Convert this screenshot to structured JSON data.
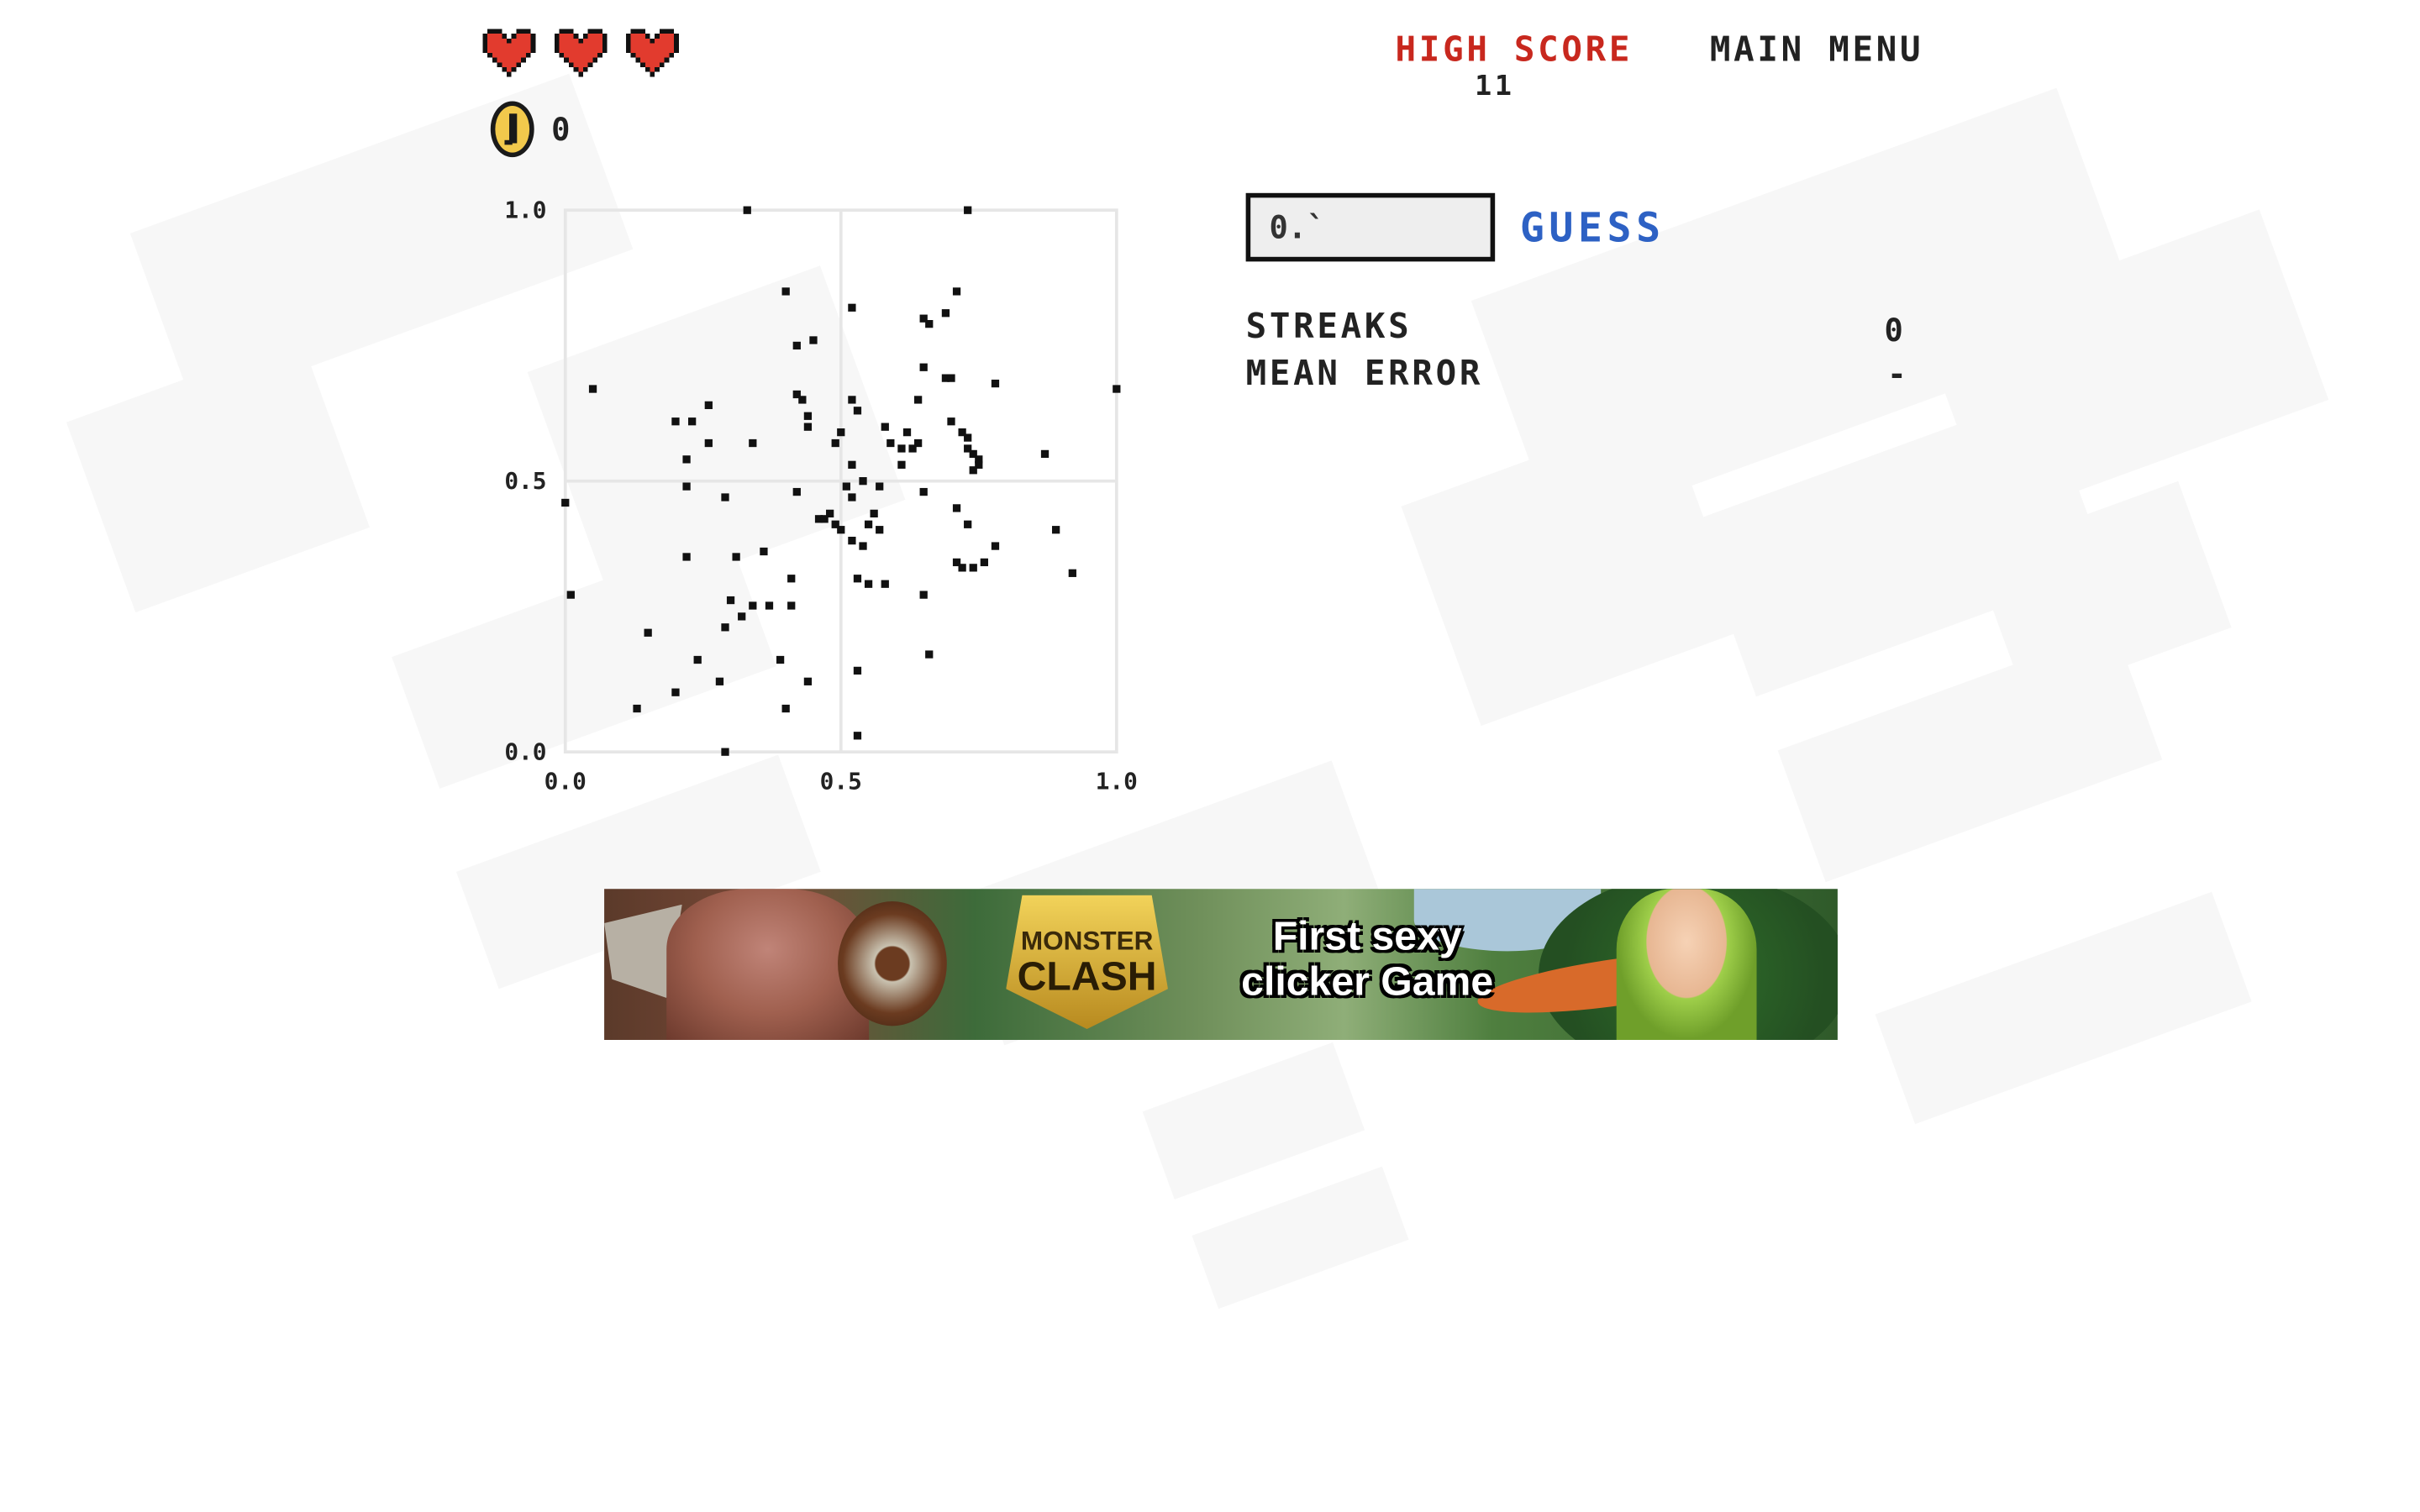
{
  "status": {
    "hearts": 3,
    "coins": "0"
  },
  "header": {
    "high_score_label": "HIGH SCORE",
    "high_score_value": "11",
    "main_menu_label": "MAIN MENU"
  },
  "guess": {
    "input_value": "0.`",
    "button_label": "GUESS"
  },
  "stats": {
    "streaks_label": "STREAKS",
    "streaks_value": "0",
    "mean_error_label": "MEAN ERROR",
    "mean_error_value": "-"
  },
  "ad": {
    "logo_top": "MONSTER",
    "logo_bottom": "CLASH",
    "headline": "First sexy clicker Game"
  },
  "colors": {
    "heart": "#e23b2e",
    "high_score": "#c8281e",
    "guess_button": "#2d61c4",
    "coin": "#f2c94c"
  },
  "chart_data": {
    "type": "scatter",
    "xlim": [
      0,
      1
    ],
    "ylim": [
      0,
      1
    ],
    "xticks": [
      "0.0",
      "0.5",
      "1.0"
    ],
    "yticks": [
      "0.0",
      "0.5",
      "1.0"
    ],
    "grid": true,
    "points": [
      [
        0.33,
        1.0
      ],
      [
        0.73,
        1.0
      ],
      [
        0.4,
        0.85
      ],
      [
        0.52,
        0.82
      ],
      [
        0.71,
        0.85
      ],
      [
        0.69,
        0.81
      ],
      [
        0.65,
        0.8
      ],
      [
        0.66,
        0.79
      ],
      [
        0.45,
        0.76
      ],
      [
        0.42,
        0.75
      ],
      [
        0.65,
        0.71
      ],
      [
        0.69,
        0.69
      ],
      [
        0.7,
        0.69
      ],
      [
        0.78,
        0.68
      ],
      [
        1.0,
        0.67
      ],
      [
        0.05,
        0.67
      ],
      [
        0.42,
        0.66
      ],
      [
        0.43,
        0.65
      ],
      [
        0.52,
        0.65
      ],
      [
        0.64,
        0.65
      ],
      [
        0.26,
        0.64
      ],
      [
        0.53,
        0.63
      ],
      [
        0.44,
        0.62
      ],
      [
        0.2,
        0.61
      ],
      [
        0.23,
        0.61
      ],
      [
        0.58,
        0.6
      ],
      [
        0.7,
        0.61
      ],
      [
        0.44,
        0.6
      ],
      [
        0.5,
        0.59
      ],
      [
        0.62,
        0.59
      ],
      [
        0.72,
        0.59
      ],
      [
        0.73,
        0.58
      ],
      [
        0.26,
        0.57
      ],
      [
        0.34,
        0.57
      ],
      [
        0.49,
        0.57
      ],
      [
        0.59,
        0.57
      ],
      [
        0.61,
        0.56
      ],
      [
        0.63,
        0.56
      ],
      [
        0.64,
        0.57
      ],
      [
        0.73,
        0.56
      ],
      [
        0.74,
        0.55
      ],
      [
        0.75,
        0.54
      ],
      [
        0.22,
        0.54
      ],
      [
        0.87,
        0.55
      ],
      [
        0.52,
        0.53
      ],
      [
        0.61,
        0.53
      ],
      [
        0.75,
        0.53
      ],
      [
        0.74,
        0.52
      ],
      [
        0.54,
        0.5
      ],
      [
        0.51,
        0.49
      ],
      [
        0.22,
        0.49
      ],
      [
        0.57,
        0.49
      ],
      [
        0.65,
        0.48
      ],
      [
        0.52,
        0.47
      ],
      [
        0.29,
        0.47
      ],
      [
        0.42,
        0.48
      ],
      [
        0.0,
        0.46
      ],
      [
        0.71,
        0.45
      ],
      [
        0.56,
        0.44
      ],
      [
        0.48,
        0.44
      ],
      [
        0.46,
        0.43
      ],
      [
        0.47,
        0.43
      ],
      [
        0.55,
        0.42
      ],
      [
        0.49,
        0.42
      ],
      [
        0.73,
        0.42
      ],
      [
        0.5,
        0.41
      ],
      [
        0.89,
        0.41
      ],
      [
        0.57,
        0.41
      ],
      [
        0.52,
        0.39
      ],
      [
        0.78,
        0.38
      ],
      [
        0.54,
        0.38
      ],
      [
        0.36,
        0.37
      ],
      [
        0.22,
        0.36
      ],
      [
        0.31,
        0.36
      ],
      [
        0.71,
        0.35
      ],
      [
        0.72,
        0.34
      ],
      [
        0.74,
        0.34
      ],
      [
        0.76,
        0.35
      ],
      [
        0.92,
        0.33
      ],
      [
        0.53,
        0.32
      ],
      [
        0.55,
        0.31
      ],
      [
        0.58,
        0.31
      ],
      [
        0.41,
        0.32
      ],
      [
        0.01,
        0.29
      ],
      [
        0.65,
        0.29
      ],
      [
        0.3,
        0.28
      ],
      [
        0.41,
        0.27
      ],
      [
        0.34,
        0.27
      ],
      [
        0.37,
        0.27
      ],
      [
        0.32,
        0.25
      ],
      [
        0.29,
        0.23
      ],
      [
        0.15,
        0.22
      ],
      [
        0.66,
        0.18
      ],
      [
        0.24,
        0.17
      ],
      [
        0.39,
        0.17
      ],
      [
        0.53,
        0.15
      ],
      [
        0.44,
        0.13
      ],
      [
        0.28,
        0.13
      ],
      [
        0.2,
        0.11
      ],
      [
        0.13,
        0.08
      ],
      [
        0.4,
        0.08
      ],
      [
        0.53,
        0.03
      ],
      [
        0.29,
        0.0
      ]
    ]
  }
}
